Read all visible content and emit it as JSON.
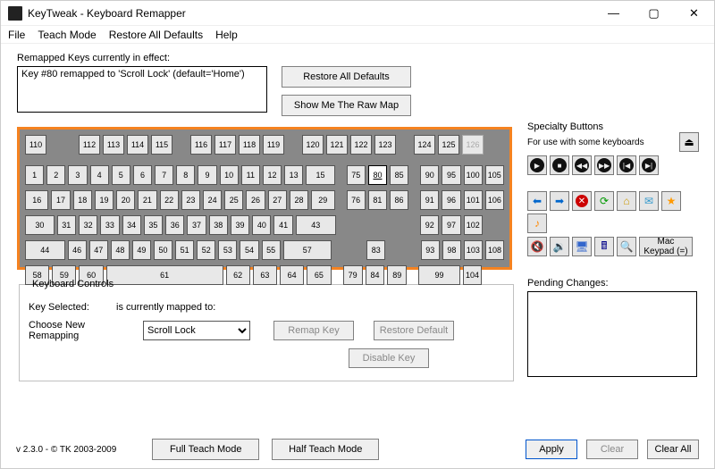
{
  "window": {
    "title": "KeyTweak  -  Keyboard Remapper"
  },
  "menu": {
    "file": "File",
    "teach": "Teach Mode",
    "restore": "Restore All Defaults",
    "help": "Help"
  },
  "remapped": {
    "label": "Remapped Keys currently in effect:",
    "item": "Key #80 remapped to 'Scroll Lock' (default='Home')"
  },
  "buttons": {
    "restore_all": "Restore All Defaults",
    "show_raw": "Show Me The Raw Map",
    "remap_key": "Remap Key",
    "restore_default": "Restore Default",
    "disable_key": "Disable Key",
    "full_teach": "Full Teach Mode",
    "half_teach": "Half Teach Mode",
    "apply": "Apply",
    "clear": "Clear",
    "clear_all": "Clear All"
  },
  "controls": {
    "legend": "Keyboard Controls",
    "key_selected_label": "Key Selected:",
    "mapped_to_label": "is currently mapped to:",
    "choose_label": "Choose New Remapping",
    "select_value": "Scroll Lock"
  },
  "specialty": {
    "label": "Specialty Buttons",
    "sub": "For use with some keyboards",
    "mac_keypad": "Mac\nKeypad (=)"
  },
  "pending": {
    "label": "Pending Changes:"
  },
  "footer": {
    "version": "v 2.3.0 - © TK 2003-2009"
  },
  "keys": {
    "r1a": [
      "110"
    ],
    "r1b": [
      "112",
      "113",
      "114",
      "115"
    ],
    "r1c": [
      "116",
      "117",
      "118",
      "119"
    ],
    "r1d": [
      "120",
      "121",
      "122",
      "123"
    ],
    "r1e": [
      "124",
      "125",
      "126"
    ],
    "r2m": [
      "1",
      "2",
      "3",
      "4",
      "5",
      "6",
      "7",
      "8",
      "9",
      "10",
      "11",
      "12",
      "13",
      "15"
    ],
    "r2nav": [
      "75",
      "80",
      "85"
    ],
    "r2num": [
      "90",
      "95",
      "100",
      "105"
    ],
    "r3m": [
      "16",
      "17",
      "18",
      "19",
      "20",
      "21",
      "22",
      "23",
      "24",
      "25",
      "26",
      "27",
      "28",
      "29"
    ],
    "r3nav": [
      "76",
      "81",
      "86"
    ],
    "r3num": [
      "91",
      "96",
      "101"
    ],
    "r3numt": "106",
    "r4m": [
      "30",
      "31",
      "32",
      "33",
      "34",
      "35",
      "36",
      "37",
      "38",
      "39",
      "40",
      "41",
      "43"
    ],
    "r4num": [
      "92",
      "97",
      "102"
    ],
    "r5m": [
      "44",
      "46",
      "47",
      "48",
      "49",
      "50",
      "51",
      "52",
      "53",
      "54",
      "55",
      "57"
    ],
    "r5nav": [
      "83"
    ],
    "r5num": [
      "93",
      "98",
      "103"
    ],
    "r5numt": "108",
    "r6m": [
      "58",
      "59",
      "60",
      "61",
      "62",
      "63",
      "64",
      "65"
    ],
    "r6nav": [
      "79",
      "84",
      "89"
    ],
    "r6num": [
      "99",
      "104"
    ]
  }
}
